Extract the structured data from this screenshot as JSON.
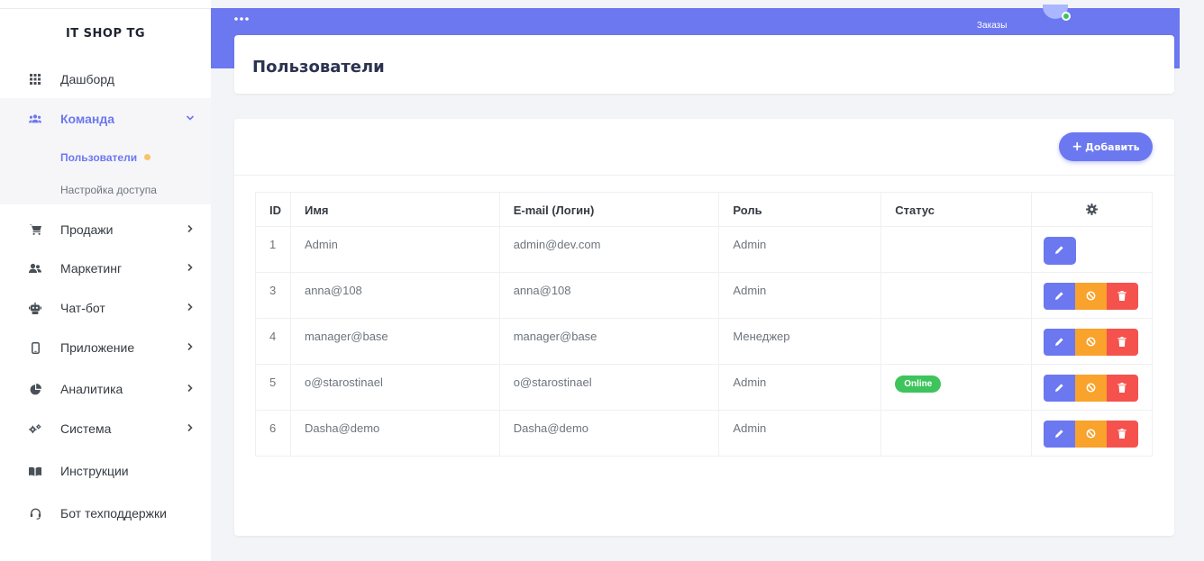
{
  "brand": {
    "name": "IT SHOP TG"
  },
  "sidebar": {
    "items": [
      {
        "label": "Дашборд",
        "icon": "grid-icon",
        "has_children": false
      },
      {
        "label": "Команда",
        "icon": "team-icon",
        "has_children": true,
        "expanded": true,
        "children": [
          {
            "label": "Пользователи",
            "active": true
          },
          {
            "label": "Настройка доступа",
            "active": false
          }
        ]
      },
      {
        "label": "Продажи",
        "icon": "cart-icon",
        "has_children": true
      },
      {
        "label": "Маркетинг",
        "icon": "users-icon",
        "has_children": true
      },
      {
        "label": "Чат-бот",
        "icon": "robot-icon",
        "has_children": true
      },
      {
        "label": "Приложение",
        "icon": "mobile-icon",
        "has_children": true
      },
      {
        "label": "Аналитика",
        "icon": "pie-chart-icon",
        "has_children": true
      },
      {
        "label": "Система",
        "icon": "gears-icon",
        "has_children": true
      },
      {
        "label": "Инструкции",
        "icon": "book-icon",
        "has_children": false
      },
      {
        "label": "Бот техподдержки",
        "icon": "headset-icon",
        "has_children": false
      }
    ]
  },
  "header": {
    "orders_label": "Заказы",
    "user_status": "online"
  },
  "page": {
    "title": "Пользователи"
  },
  "toolbar": {
    "add_label": "Добавить"
  },
  "table": {
    "columns": [
      "ID",
      "Имя",
      "E-mail (Логин)",
      "Роль",
      "Статус"
    ],
    "settings_icon": "gear-icon",
    "rows": [
      {
        "id": "1",
        "name": "Admin",
        "email": "admin@dev.com",
        "role": "Admin",
        "status": "",
        "actions": [
          "edit"
        ]
      },
      {
        "id": "3",
        "name": "anna@108",
        "email": "anna@108",
        "role": "Admin",
        "status": "",
        "actions": [
          "edit",
          "block",
          "delete"
        ]
      },
      {
        "id": "4",
        "name": "manager@base",
        "email": "manager@base",
        "role": "Менеджер",
        "status": "",
        "actions": [
          "edit",
          "block",
          "delete"
        ]
      },
      {
        "id": "5",
        "name": "o@starostinael",
        "email": "o@starostinael",
        "role": "Admin",
        "status": "Online",
        "actions": [
          "edit",
          "block",
          "delete"
        ]
      },
      {
        "id": "6",
        "name": "Dasha@demo",
        "email": "Dasha@demo",
        "role": "Admin",
        "status": "",
        "actions": [
          "edit",
          "block",
          "delete"
        ]
      }
    ]
  },
  "colors": {
    "accent": "#6c78f0",
    "warning": "#f9a22c",
    "danger": "#f5524d",
    "success": "#3ec45c",
    "active_dot": "#f7c36b"
  }
}
